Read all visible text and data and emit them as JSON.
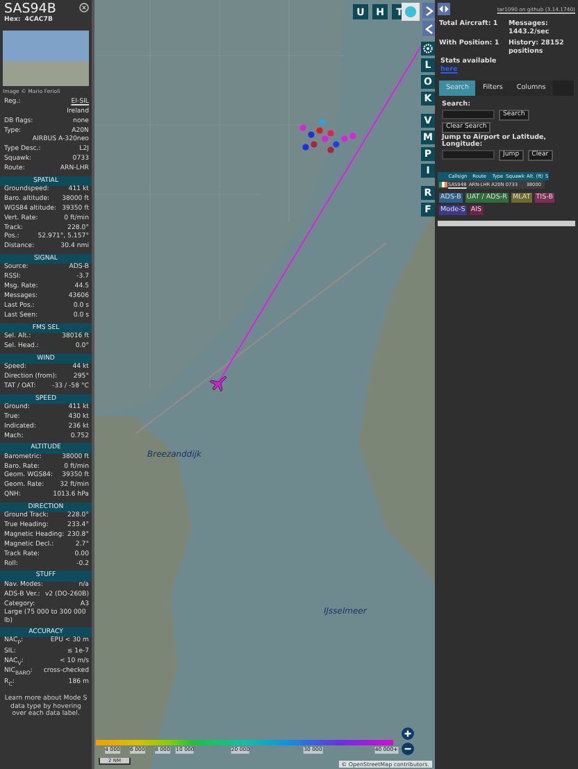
{
  "aircraft": {
    "callsign": "SAS94B",
    "hex_label": "Hex:",
    "hex": "4CAC7B",
    "photo_credit": "Image © Mario Ferioli"
  },
  "info_rows": [
    {
      "kind": "link_pair",
      "label": "Reg.:",
      "value": "EI-SIL"
    },
    {
      "kind": "right_note",
      "text": "Ireland"
    },
    {
      "kind": "pair",
      "label": "DB flags:",
      "value": "none"
    },
    {
      "kind": "pair",
      "label": "Type:",
      "value": "A20N"
    },
    {
      "kind": "right_note",
      "text": "AIRBUS A-320neo"
    },
    {
      "kind": "pair",
      "label": "Type Desc.:",
      "value": "L2J"
    },
    {
      "kind": "pair",
      "label": "Squawk:",
      "value": "0733"
    },
    {
      "kind": "pair",
      "label": "Route:",
      "value": "ARN-LHR"
    }
  ],
  "sections": [
    {
      "title": "SPATIAL",
      "rows": [
        {
          "kind": "pair",
          "label": "Groundspeed:",
          "value": "411 kt"
        },
        {
          "kind": "pair",
          "label": "Baro. altitude:",
          "value": "38000 ft"
        },
        {
          "kind": "pair",
          "label": "WGS84 altitude:",
          "value": "39350 ft"
        },
        {
          "kind": "pair",
          "label": "Vert. Rate:",
          "value": "0 ft/min"
        },
        {
          "kind": "pair",
          "label": "Track:",
          "value": "228.0°"
        },
        {
          "kind": "pair",
          "label": "Pos.:",
          "value": "52.971°, 5.157°"
        },
        {
          "kind": "pair",
          "label": "Distance:",
          "value": "30.4 nmi"
        }
      ]
    },
    {
      "title": "SIGNAL",
      "rows": [
        {
          "kind": "pair",
          "label": "Source:",
          "value": "ADS-B"
        },
        {
          "kind": "pair",
          "label": "RSSI:",
          "value": "-3.7"
        },
        {
          "kind": "pair",
          "label": "Msg. Rate:",
          "value": "44.5"
        },
        {
          "kind": "pair",
          "label": "Messages:",
          "value": "43606"
        },
        {
          "kind": "pair",
          "label": "Last Pos.:",
          "value": "0.0 s"
        },
        {
          "kind": "pair",
          "label": "Last Seen:",
          "value": "0.0 s"
        }
      ]
    },
    {
      "title": "FMS SEL",
      "rows": [
        {
          "kind": "pair",
          "label": "Sel. Alt.:",
          "value": "38016 ft"
        },
        {
          "kind": "pair",
          "label": "Sel. Head.:",
          "value": "0.0°"
        }
      ]
    },
    {
      "title": "WIND",
      "rows": [
        {
          "kind": "pair",
          "label": "Speed:",
          "value": "44 kt"
        },
        {
          "kind": "pair",
          "label": "Direction (from):",
          "value": "295°"
        },
        {
          "kind": "pair",
          "label": "TAT / OAT:",
          "value": "-33 / -58 °C"
        }
      ]
    },
    {
      "title": "SPEED",
      "rows": [
        {
          "kind": "pair",
          "label": "Ground:",
          "value": "411 kt"
        },
        {
          "kind": "pair",
          "label": "True:",
          "value": "430 kt"
        },
        {
          "kind": "pair",
          "label": "Indicated:",
          "value": "236 kt"
        },
        {
          "kind": "pair",
          "label": "Mach:",
          "value": "0.752"
        }
      ]
    },
    {
      "title": "ALTITUDE",
      "rows": [
        {
          "kind": "pair",
          "label": "Barometric:",
          "value": "38000 ft"
        },
        {
          "kind": "pair",
          "label": "Baro. Rate:",
          "value": "0 ft/min"
        },
        {
          "kind": "pair",
          "label": "Geom. WGS84:",
          "value": "39350 ft"
        },
        {
          "kind": "pair",
          "label": "Geom. Rate:",
          "value": "32 ft/min"
        },
        {
          "kind": "pair",
          "label": "QNH:",
          "value": "1013.6 hPa"
        }
      ]
    },
    {
      "title": "DIRECTION",
      "rows": [
        {
          "kind": "pair",
          "label": "Ground Track:",
          "value": "228.0°"
        },
        {
          "kind": "pair",
          "label": "True Heading:",
          "value": "233.4°"
        },
        {
          "kind": "pair",
          "label": "Magnetic Heading:",
          "value": "230.8°"
        },
        {
          "kind": "pair",
          "label": "Magnetic Decl.:",
          "value": "2.7°"
        },
        {
          "kind": "pair",
          "label": "Track Rate:",
          "value": "0.00"
        },
        {
          "kind": "pair",
          "label": "Roll:",
          "value": "-0.2"
        }
      ]
    },
    {
      "title": "STUFF",
      "rows": [
        {
          "kind": "pair",
          "label": "Nav. Modes:",
          "value": "n/a"
        },
        {
          "kind": "pair",
          "label": "ADS-B Ver.:",
          "value": "v2 (DO-260B)"
        },
        {
          "kind": "pair",
          "label": "Category:",
          "value": "A3"
        },
        {
          "kind": "left_note",
          "text": "Large (75 000 to 300 000 lb)"
        }
      ]
    },
    {
      "title": "ACCURACY",
      "rows": [
        {
          "kind": "pair",
          "label": "NAC$_{P}$:",
          "value": "EPU < 30 m"
        },
        {
          "kind": "pair",
          "label": "SIL:",
          "value": "≤ 1e-7"
        },
        {
          "kind": "pair",
          "label": "NAC$_{V}$:",
          "value": "< 10 m/s"
        },
        {
          "kind": "pair",
          "label": "NIC$_{BARO}$:",
          "value": "cross-checked"
        },
        {
          "kind": "pair",
          "label": "R$_{C}$:",
          "value": "186 m"
        }
      ]
    }
  ],
  "footer_note": "Learn more about Mode S data type by hovering over each data label.",
  "map": {
    "top_buttons": [
      "U",
      "H",
      "T"
    ],
    "side_buttons": [
      {
        "kind": "gear"
      },
      {
        "kind": "letter",
        "label": "L"
      },
      {
        "kind": "letter",
        "label": "O"
      },
      {
        "kind": "letter",
        "label": "K"
      },
      {
        "kind": "letter",
        "label": "V"
      },
      {
        "kind": "letter",
        "label": "M"
      },
      {
        "kind": "letter",
        "label": "P"
      },
      {
        "kind": "letter",
        "label": "I"
      },
      {
        "kind": "letter",
        "label": "R"
      },
      {
        "kind": "letter",
        "label": "F"
      }
    ],
    "place_labels": [
      "Breezanddijk",
      "IJsselmeer"
    ],
    "altitude_ticks": [
      "4 000",
      "6 000",
      "8 000",
      "10 000",
      "20 000",
      "30 000",
      "40 000+"
    ],
    "scale": "2 NM",
    "attribution_prefix": "© ",
    "attribution_link": "OpenStreetMap",
    "attribution_suffix": " contributors."
  },
  "panel": {
    "version_link": "tar1090 on github (3.14.1740)",
    "stats": [
      {
        "label": "Total Aircraft:",
        "value": "1"
      },
      {
        "label": "Messages:",
        "value": "1443.2/sec"
      },
      {
        "label": "With Position:",
        "value": "1"
      },
      {
        "label": "History:",
        "value": "28152 positions"
      }
    ],
    "stats_note": "Stats available",
    "stats_link": "here",
    "tabs": [
      {
        "label": "Search",
        "selected": true
      },
      {
        "label": "Filters",
        "selected": false
      },
      {
        "label": "Columns",
        "selected": false
      }
    ],
    "search_label": "Search:",
    "search_button": "Search",
    "clear_search_button": "Clear Search",
    "jump_label": "Jump to Airport or Latitude, Longitude:",
    "jump_button": "Jump",
    "clear_button": "Clear",
    "table": {
      "columns": [
        "Callsign",
        "Route",
        "Type",
        "Squawk",
        "Alt. (ft)",
        "S"
      ],
      "rows": [
        {
          "callsign": "SAS94B",
          "route": "ARN-LHR",
          "type": "A20N",
          "squawk": "0733",
          "altitude": "38000"
        }
      ]
    },
    "legend": [
      {
        "label": "ADS-B",
        "color": "#2e5f86"
      },
      {
        "label": "UAT / ADS-R",
        "color": "#2f6e3c"
      },
      {
        "label": "MLAT",
        "color": "#6e6a2c"
      },
      {
        "label": "TIS-B",
        "color": "#7c2f52"
      },
      {
        "label": "Mode-S",
        "color": "#3a3a86"
      },
      {
        "label": "AIS",
        "color": "#6a2447"
      }
    ]
  }
}
